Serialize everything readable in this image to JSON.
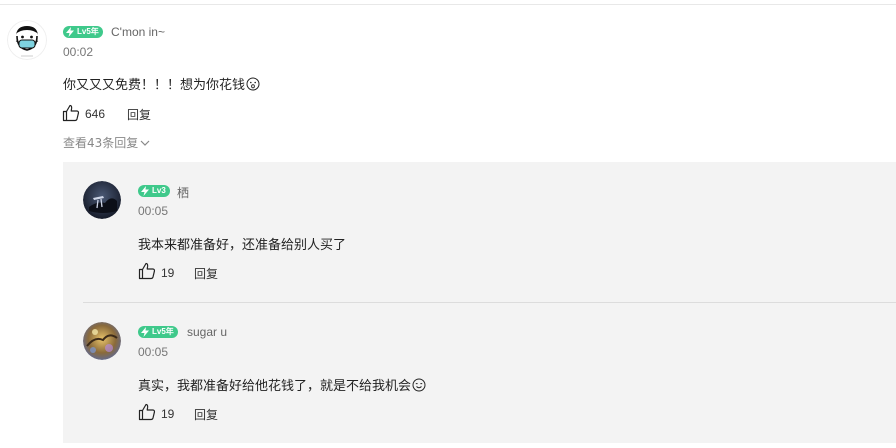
{
  "comment": {
    "username": "C'mon in~",
    "level": "Lv5年",
    "time": "00:02",
    "content": "你又又又免费！！！想为你花钱",
    "likes": "646",
    "reply_label": "回复",
    "view_replies": "查看43条回复"
  },
  "replies": [
    {
      "username": "栖",
      "level": "Lv3",
      "time": "00:05",
      "content": "我本来都准备好，还准备给别人买了",
      "likes": "19",
      "reply_label": "回复"
    },
    {
      "username": "sugar u",
      "level": "Lv5年",
      "time": "00:05",
      "content": "真实，我都准备好给他花钱了，就是不给我机会",
      "likes": "19",
      "reply_label": "回复"
    }
  ],
  "colors": {
    "level_badge": "#3fc98b",
    "reply_panel_bg": "#f3f3f3"
  },
  "icons": [
    "face-mask-avatar",
    "lightning-icon",
    "thumbs-up-icon",
    "chevron-down-icon",
    "surprised-emoji-icon",
    "smile-emoji-icon"
  ]
}
